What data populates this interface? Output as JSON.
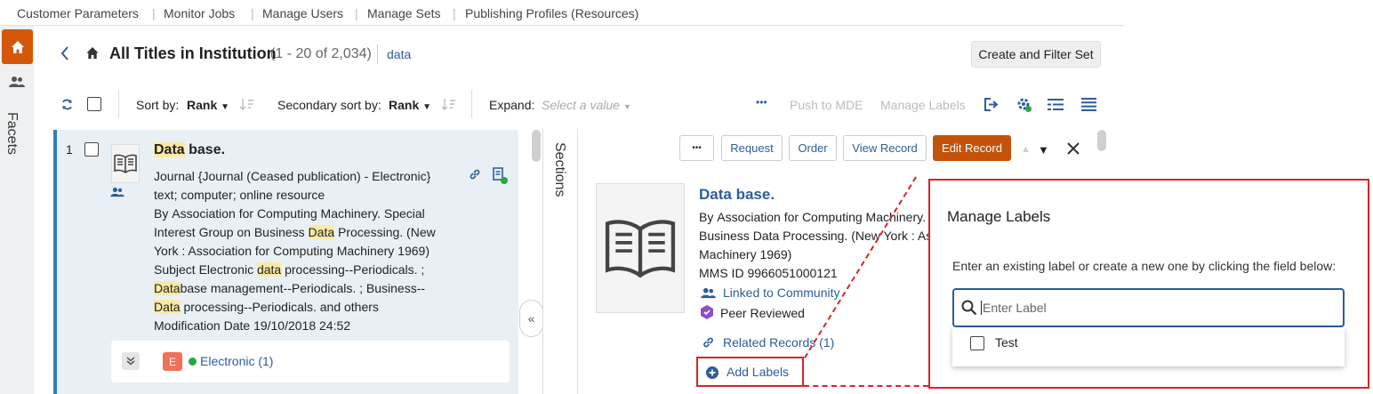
{
  "topnav": {
    "items": [
      "Customer Parameters",
      "Monitor Jobs",
      "Manage Users",
      "Manage Sets",
      "Publishing Profiles (Resources)"
    ]
  },
  "sidebar": {
    "facets_label": "Facets"
  },
  "header": {
    "title": "All Titles in Institution",
    "count": "(1 - 20 of 2,034)",
    "query": "data",
    "create_set_button": "Create and Filter Set"
  },
  "toolbar": {
    "sort_label": "Sort by:",
    "sort_value": "Rank",
    "secondary_sort_label": "Secondary sort by:",
    "secondary_sort_value": "Rank",
    "expand_label": "Expand:",
    "expand_placeholder": "Select a value",
    "more": "•••",
    "push_to_mde": "Push to MDE",
    "manage_labels": "Manage Labels"
  },
  "result": {
    "index": "1",
    "title_hl": "Data",
    "title_rest": " base.",
    "line1": "Journal {Journal (Ceased publication) - Electronic}",
    "line2": "text; computer; online resource",
    "by_prefix": "By ",
    "by_line1": "Association for Computing Machinery. Special",
    "by_line2": "Interest Group on Business ",
    "by_line2_hl": "Data",
    "by_line2_rest": " Processing. (New",
    "by_line3": "York : Association for Computing Machinery 1969)",
    "subject_prefix": "Subject ",
    "subject_line1_a": "Electronic ",
    "subject_line1_hl": "data",
    "subject_line1_b": " processing--Periodicals. ;",
    "subject_line2_hl": "Data",
    "subject_line2_b": "base management--Periodicals. ; Business--",
    "subject_line3_hl": "Data",
    "subject_line3_b": " processing--Periodicals. and others",
    "mod_prefix": "Modification Date ",
    "mod_date": "19/10/2018 24:52",
    "badge": "E",
    "electronic": "Electronic (1)"
  },
  "sections_label": "Sections",
  "detail": {
    "more": "•••",
    "request": "Request",
    "order": "Order",
    "view_record": "View Record",
    "edit_record": "Edit Record",
    "title": "Data base.",
    "by_prefix": "By ",
    "by_line1": "Association for Computing Machinery.",
    "by_line2": "Business Data Processing. (New York : As",
    "by_line3": "Machinery 1969)",
    "mms_label": "MMS ID ",
    "mms_value": "9966051000121",
    "linked": "Linked to Community",
    "peer": "Peer Reviewed",
    "related": "Related Records (1)",
    "add_labels": "Add Labels"
  },
  "modal": {
    "title": "Manage Labels",
    "instruction": "Enter an existing label or create a new one by clicking the field below:",
    "placeholder": "Enter Label",
    "option": "Test"
  },
  "colors": {
    "accent": "#d4570a",
    "link": "#2d5d9a",
    "highlight": "#d52525"
  }
}
